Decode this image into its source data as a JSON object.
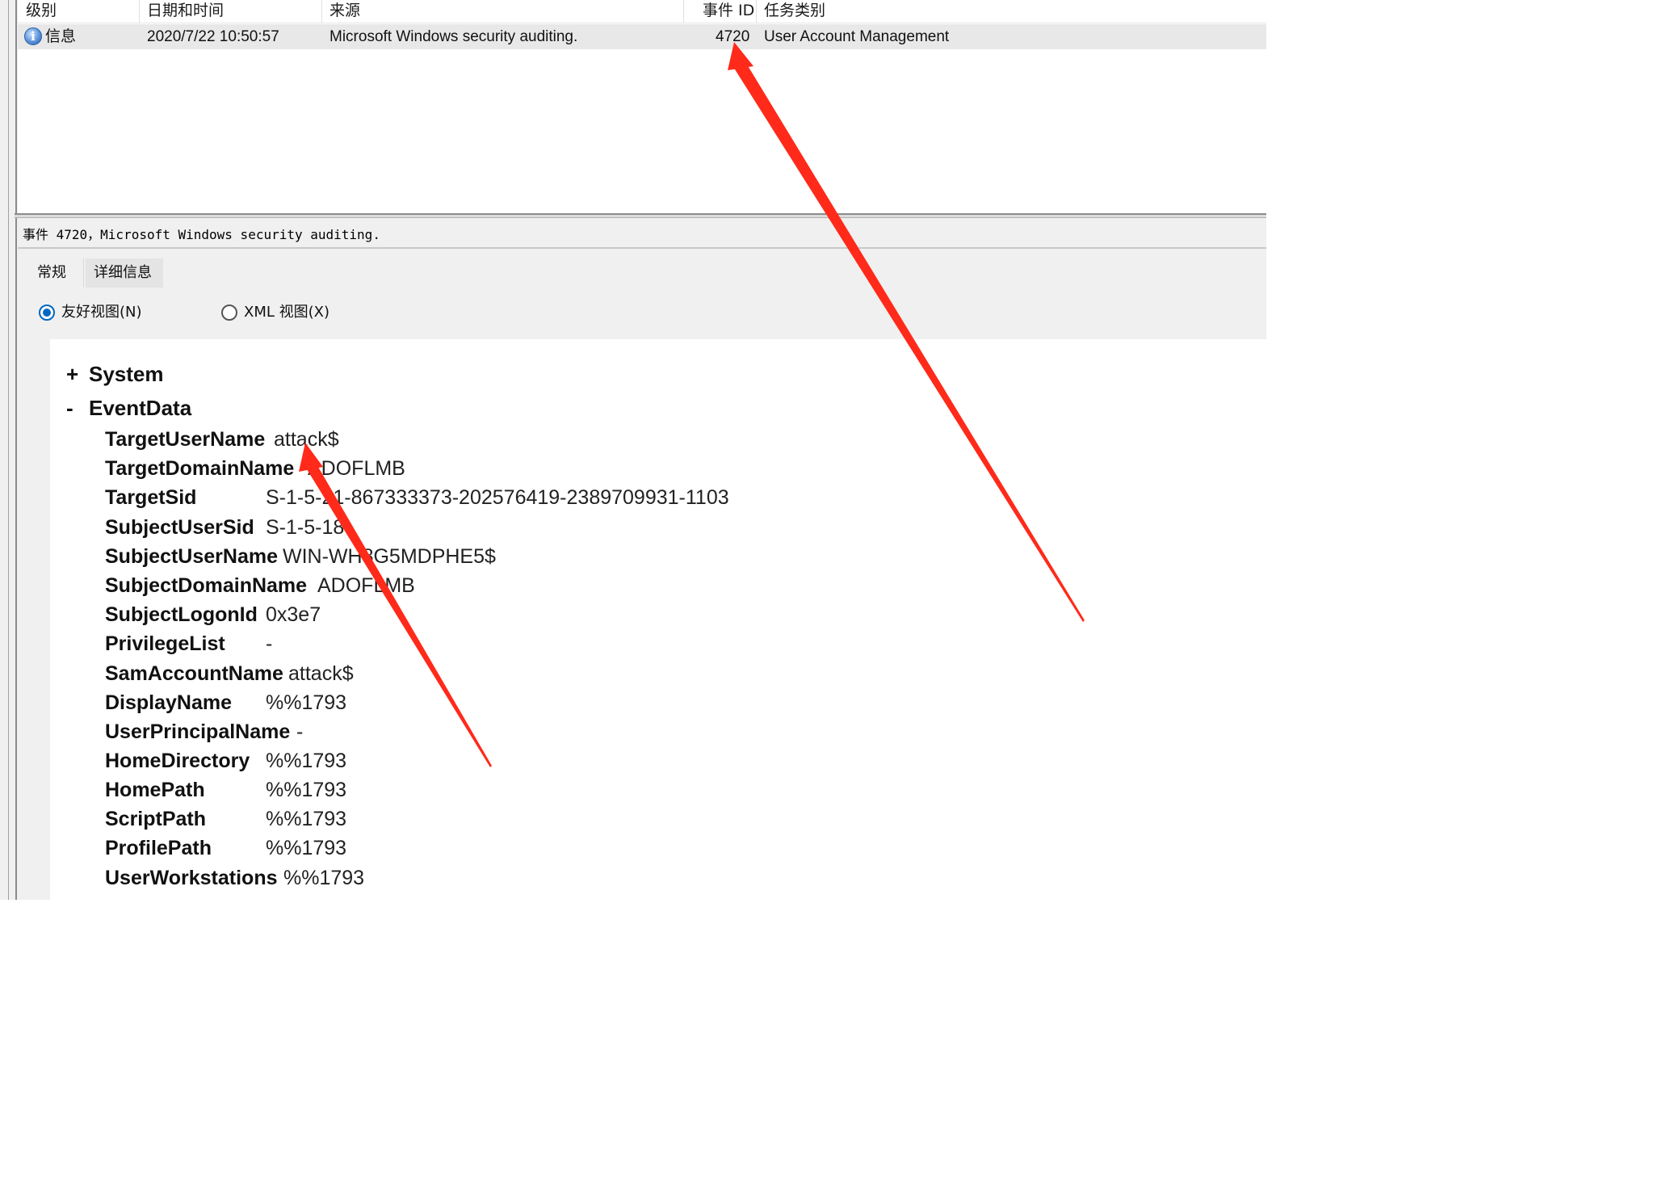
{
  "columns": {
    "level": "级别",
    "datetime": "日期和时间",
    "source": "来源",
    "event_id": "事件 ID",
    "task_category": "任务类别"
  },
  "event": {
    "level": "信息",
    "datetime": "2020/7/22 10:50:57",
    "source": "Microsoft Windows security auditing.",
    "event_id": "4720",
    "task_category": "User Account Management"
  },
  "detail": {
    "title": "事件 4720，Microsoft Windows security auditing.",
    "tabs": [
      "常规",
      "详细信息"
    ],
    "views": {
      "friendly": "友好视图(N)",
      "xml": "XML 视图(X)"
    },
    "tree": {
      "system_sign": "+",
      "system_label": "System",
      "eventdata_sign": "-",
      "eventdata_label": "EventData"
    },
    "fields": [
      {
        "name": "TargetUserName",
        "value": "attack$"
      },
      {
        "name": "TargetDomainName",
        "value": "ADOFLMB"
      },
      {
        "name": "TargetSid",
        "value": "S-1-5-21-867333373-202576419-2389709931-1103"
      },
      {
        "name": "SubjectUserSid",
        "value": "S-1-5-18"
      },
      {
        "name": "SubjectUserName",
        "value": "WIN-WH8G5MDPHE5$"
      },
      {
        "name": "SubjectDomainName",
        "value": "ADOFLMB"
      },
      {
        "name": "SubjectLogonId",
        "value": "0x3e7"
      },
      {
        "name": "PrivilegeList",
        "value": "-"
      },
      {
        "name": "SamAccountName",
        "value": "attack$"
      },
      {
        "name": "DisplayName",
        "value": "%%1793"
      },
      {
        "name": "UserPrincipalName",
        "value": "-"
      },
      {
        "name": "HomeDirectory",
        "value": "%%1793"
      },
      {
        "name": "HomePath",
        "value": "%%1793"
      },
      {
        "name": "ScriptPath",
        "value": "%%1793"
      },
      {
        "name": "ProfilePath",
        "value": "%%1793"
      },
      {
        "name": "UserWorkstations",
        "value": "%%1793"
      }
    ]
  },
  "colors": {
    "annotation_arrow": "#ff2a1a",
    "radio_accent": "#0067c0",
    "selected_row": "#e8e8e8"
  }
}
